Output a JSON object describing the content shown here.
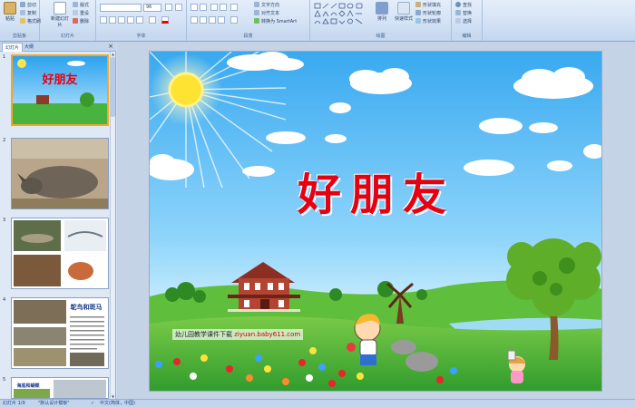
{
  "ribbon": {
    "clipboard": {
      "label": "剪贴板",
      "paste": "粘贴",
      "cut": "剪切",
      "copy": "复制",
      "format_painter": "格式刷"
    },
    "slides": {
      "label": "幻灯片",
      "new_slide": "新建幻灯片",
      "layout": "版式",
      "reset": "重设",
      "delete": "删除"
    },
    "font": {
      "label": "字体",
      "font_name": "",
      "font_size": "96"
    },
    "paragraph": {
      "label": "段落",
      "text_direction": "文字方向",
      "align_text": "对齐文本",
      "smartart": "转换为 SmartArt"
    },
    "drawing": {
      "label": "绘图",
      "arrange": "排列",
      "quick_styles": "快速样式",
      "shape_fill": "形状填充",
      "shape_outline": "形状轮廓",
      "shape_effects": "形状效果"
    },
    "editing": {
      "label": "编辑",
      "find": "查找",
      "replace": "替换",
      "select": "选择"
    }
  },
  "panel": {
    "tab_slides": "幻灯片",
    "tab_outline": "大纲",
    "close": "×",
    "thumbs": [
      {
        "num": "1"
      },
      {
        "num": "2"
      },
      {
        "num": "3"
      },
      {
        "num": "4",
        "heading": "鸵鸟和斑马"
      },
      {
        "num": "5",
        "heading": "海底和蝴蝶"
      }
    ]
  },
  "slide": {
    "title": "好朋友",
    "watermark_prefix": "幼儿园教学课件下载",
    "watermark_url": "ziyuan.baby611.com"
  },
  "status": {
    "slide_info": "幻灯片 1/9",
    "theme": "\"默认设计模板\"",
    "language": "中文(简体，中国)"
  },
  "colors": {
    "title_red": "#e60012",
    "sky_top": "#39a9f0",
    "grass": "#3fae3a",
    "selection": "#f5a623"
  }
}
